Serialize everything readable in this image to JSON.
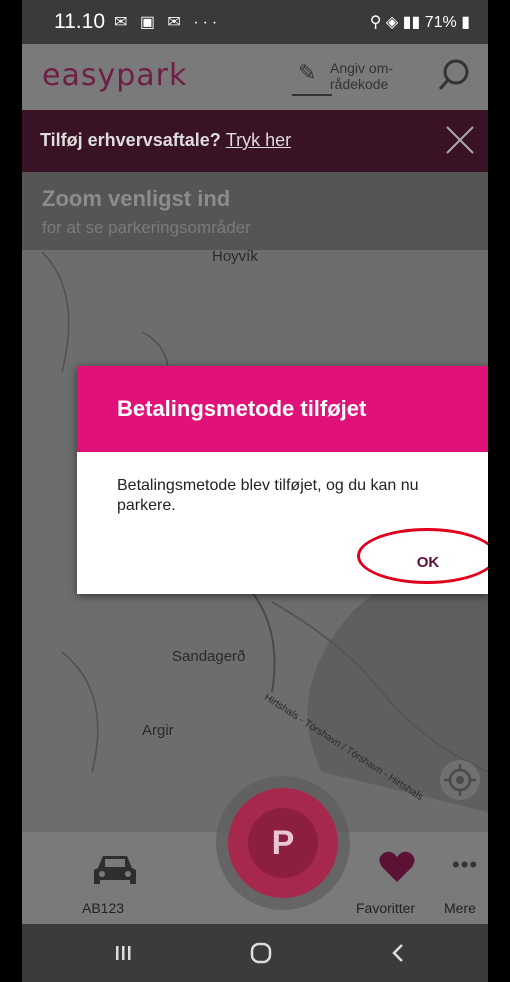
{
  "status_bar": {
    "time": "11.10",
    "left_icons": "✉ ▣ ✉ ···",
    "battery": "71%"
  },
  "app_bar": {
    "logo": "easypark",
    "area_code_label": "Angiv om-\nrådekode"
  },
  "banner": {
    "question": "Tilføj erhvervsaftale?",
    "link": "Tryk her"
  },
  "map": {
    "zoom_title": "Zoom venligst ind",
    "zoom_subtitle": "for at se parkeringsområder",
    "labels": [
      "Hoyvík",
      "Sandagerð",
      "Argir",
      "Hirtshals - Tórshavn / Tórshavn - Hirtshals"
    ]
  },
  "dialog": {
    "title": "Betalingsmetode tilføjet",
    "message": "Betalingsmetode blev tilføjet, og du kan nu parkere.",
    "ok_label": "OK"
  },
  "bottom_bar": {
    "car_label": "AB123",
    "park_label": "P",
    "favorites_label": "Favoritter",
    "more_label": "Mere"
  },
  "colors": {
    "accent": "#e0127a",
    "brand_dark": "#6e1f45",
    "highlight_ring": "#e0001b"
  }
}
